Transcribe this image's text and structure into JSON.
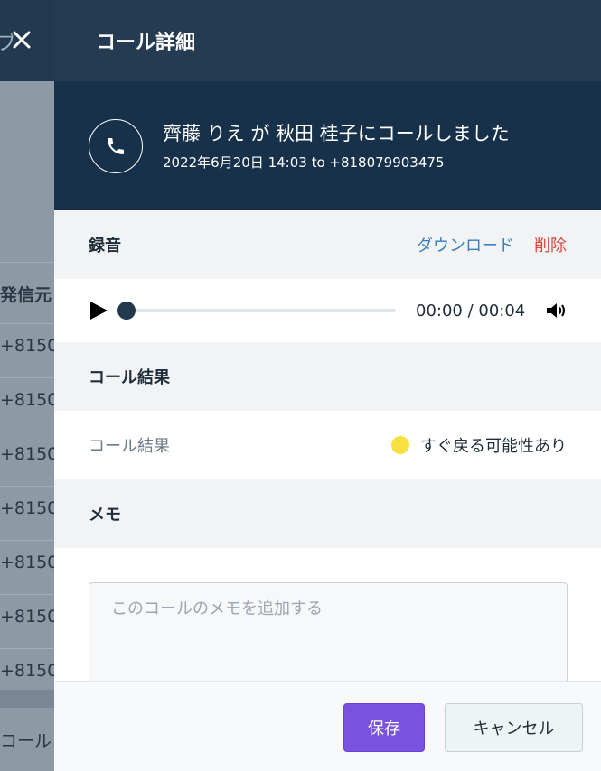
{
  "background": {
    "header_fragment": "ブ",
    "column_header": "発信元",
    "rows": [
      "+8150",
      "+8150",
      "+8150",
      "+8150",
      "+8150",
      "+8150",
      "+8150"
    ],
    "footer_fragment": "コール"
  },
  "panel": {
    "title": "コール詳細",
    "summary": {
      "headline": "齊藤 りえ が 秋田 桂子にコールしました",
      "subline": "2022年6月20日 14:03 to +818079903475"
    },
    "recording": {
      "title": "録音",
      "download_label": "ダウンロード",
      "delete_label": "削除",
      "time": "00:00 / 00:04",
      "progress": 0
    },
    "call_result": {
      "title": "コール結果",
      "label": "コール結果",
      "value": "すぐ戻る可能性あり",
      "status_color": "#f8e040"
    },
    "memo": {
      "title": "メモ",
      "placeholder": "このコールのメモを追加する",
      "value": ""
    },
    "footer": {
      "save_label": "保存",
      "cancel_label": "キャンセル"
    }
  }
}
